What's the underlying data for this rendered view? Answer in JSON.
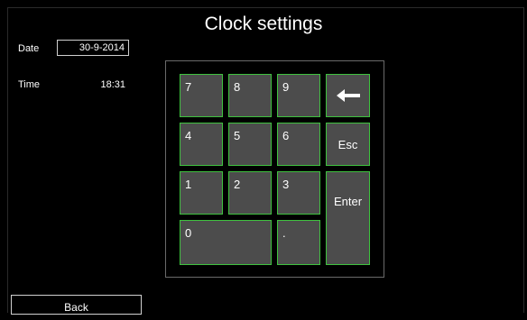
{
  "title": "Clock settings",
  "date": {
    "label": "Date",
    "value": "30-9-2014"
  },
  "time": {
    "label": "Time",
    "value": "18:31"
  },
  "keypad": {
    "keys": {
      "k7": "7",
      "k8": "8",
      "k9": "9",
      "k4": "4",
      "k5": "5",
      "k6": "6",
      "k1": "1",
      "k2": "2",
      "k3": "3",
      "k0": "0",
      "dot": ".",
      "esc": "Esc",
      "enter": "Enter",
      "backspace_icon": "left-arrow-icon"
    }
  },
  "back_label": "Back",
  "colors": {
    "background": "#000000",
    "key_fill": "#4c4c4c",
    "key_border": "#3fc23f",
    "text": "#ffffff"
  }
}
